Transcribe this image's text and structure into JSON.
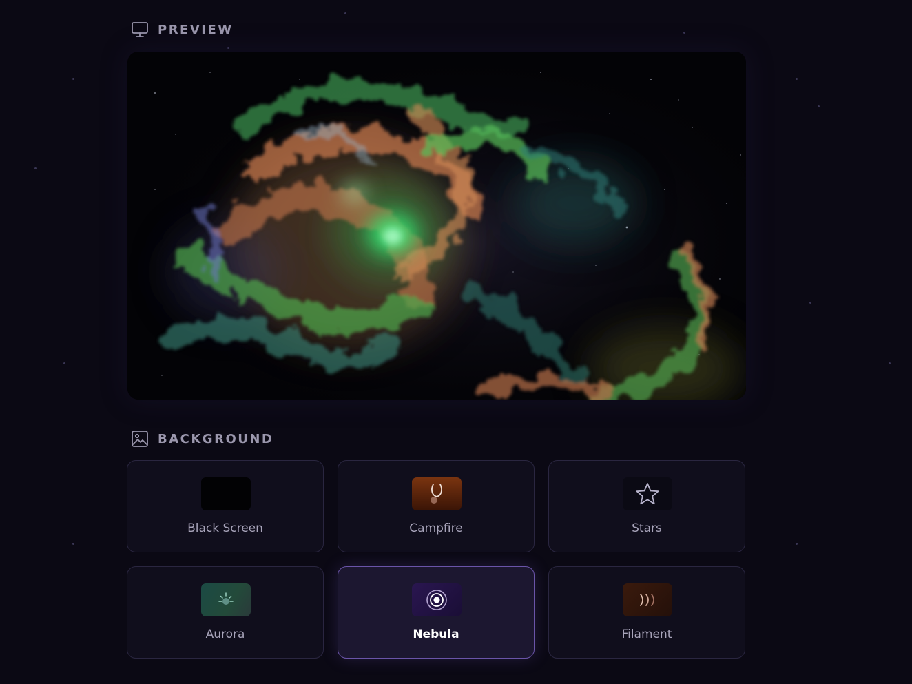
{
  "preview": {
    "heading": "PREVIEW",
    "icon": "monitor-icon"
  },
  "background": {
    "heading": "BACKGROUND",
    "icon": "image-icon",
    "selected": "Nebula",
    "options": [
      {
        "label": "Black Screen",
        "icon": "black-swatch"
      },
      {
        "label": "Campfire",
        "icon": "campfire-icon"
      },
      {
        "label": "Stars",
        "icon": "star-icon"
      },
      {
        "label": "Aurora",
        "icon": "aurora-icon"
      },
      {
        "label": "Nebula",
        "icon": "nebula-icon"
      },
      {
        "label": "Filament",
        "icon": "filament-icon"
      }
    ]
  },
  "colors": {
    "page_bg": "#0b0914",
    "card_bg": "#100e1c",
    "card_border": "#2a2640",
    "selected_border": "#6a54a8",
    "nebula_green": "#3fd06a",
    "nebula_orange": "#c87a4e",
    "nebula_teal": "#3a8a86"
  }
}
